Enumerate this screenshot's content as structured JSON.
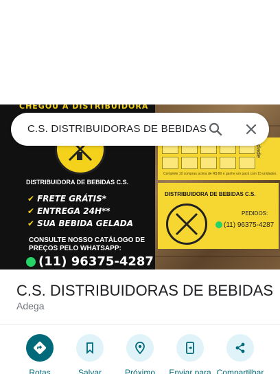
{
  "search": {
    "query": "C.S. DISTRIBUIDORAS DE BEBIDAS"
  },
  "photo": {
    "flyer": {
      "top_banner": "CHEGOU A DISTRIBUIDORA",
      "title": "DISTRIBUIDORA DE BEBIDAS C.S.",
      "perks": [
        "FRETE GRÁTIS*",
        "ENTREGA 24H**",
        "SUA BEBIDA GELADA"
      ],
      "consult": "CONSULTE NOSSO CATÁLOGO DE PREÇOS PELO WHATSAPP:",
      "phone": "(11) 96375-4287"
    },
    "loyalty_card": {
      "side_text": "idade",
      "note": "Complete 10 compras acima de R$ 80 e ganhe um pack com 15 unidades"
    },
    "business_card": {
      "title": "DISTRIBUIDORA DE BEBIDAS C.S.",
      "orders_label": "PEDIDOS:",
      "phone": "(11) 96375-4287"
    }
  },
  "place": {
    "name": "C.S. DISTRIBUIDORAS DE BEBIDAS",
    "category": "Adega"
  },
  "actions": [
    {
      "label": "Rotas",
      "icon": "directions-icon"
    },
    {
      "label": "Salvar",
      "icon": "bookmark-icon"
    },
    {
      "label": "Próximo",
      "icon": "nearby-icon"
    },
    {
      "label": "Enviar para",
      "icon": "send-to-phone-icon"
    },
    {
      "label": "Compartilhar",
      "icon": "share-icon"
    }
  ],
  "colors": {
    "accent": "#006a7a",
    "action_bg": "#dff3f9",
    "flyer_yellow": "#f4d21b"
  }
}
